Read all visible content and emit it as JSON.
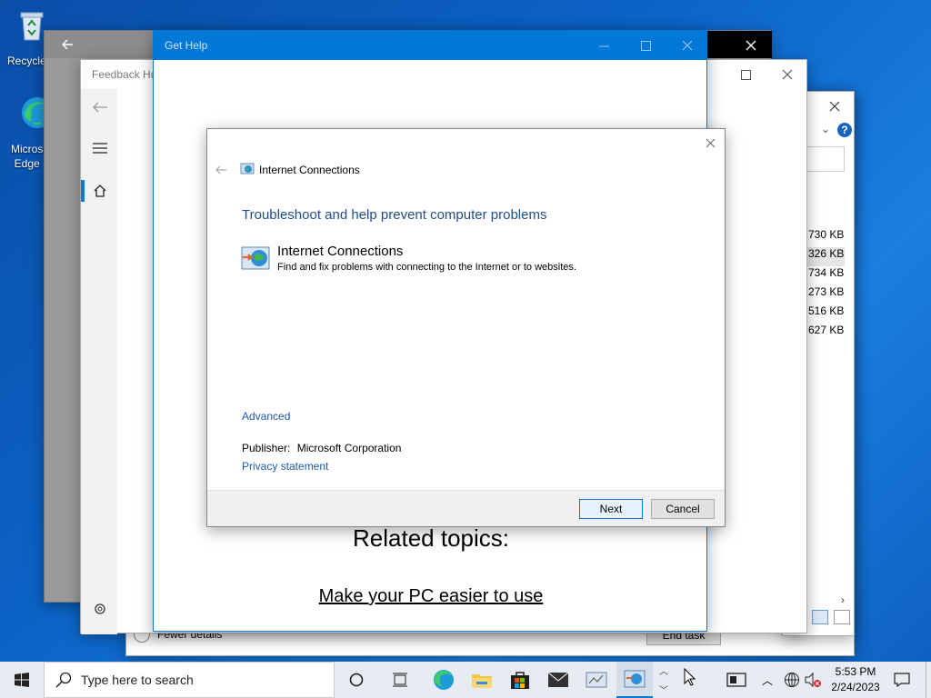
{
  "desktop": {
    "icons": [
      {
        "label": "Recycle",
        "icon": "recycle-bin-icon"
      },
      {
        "label": "Micros\nEdge",
        "icon": "edge-icon"
      }
    ]
  },
  "back_window": {
    "title_partial": "Feedback Hu",
    "sizes": [
      "730 KB",
      "326 KB",
      "734 KB",
      "273 KB",
      "516 KB",
      "627 KB"
    ],
    "fewer_details": "Fewer details",
    "end_task": "End task"
  },
  "get_help": {
    "title": "Get Help",
    "related_topics": "Related topics:",
    "link": "Make your PC easier to use"
  },
  "dialog": {
    "window_title": "Internet Connections",
    "heading": "Troubleshoot and help prevent computer problems",
    "item_title": "Internet Connections",
    "item_desc": "Find and fix problems with connecting to the Internet or to websites.",
    "advanced": "Advanced",
    "publisher_label": "Publisher:",
    "publisher_value": "Microsoft Corporation",
    "privacy": "Privacy statement",
    "next": "Next",
    "cancel": "Cancel"
  },
  "taskbar": {
    "search_placeholder": "Type here to search",
    "time": "5:53 PM",
    "date": "2/24/2023"
  },
  "colors": {
    "accent": "#0078d7",
    "link": "#1e5aa8",
    "heading": "#1e4e8c"
  }
}
